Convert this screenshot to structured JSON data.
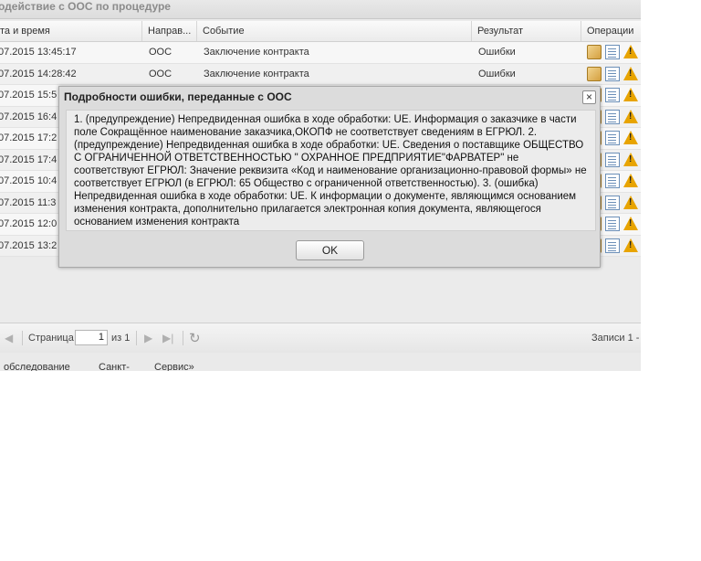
{
  "panel": {
    "title": "одействие с ООС по процедуре"
  },
  "grid": {
    "columns": [
      "та и время",
      "Направ...",
      "Событие",
      "Результат",
      "Операции"
    ],
    "rows": [
      {
        "datetime": "07.2015 13:45:17",
        "direction": "ООС",
        "event": "Заключение контракта",
        "result": "Ошибки"
      },
      {
        "datetime": "07.2015 14:28:42",
        "direction": "ООС",
        "event": "Заключение контракта",
        "result": "Ошибки"
      },
      {
        "datetime": "07.2015 15:5",
        "direction": "",
        "event": "",
        "result": ""
      },
      {
        "datetime": "07.2015 16:4",
        "direction": "",
        "event": "",
        "result": ""
      },
      {
        "datetime": "07.2015 17:2",
        "direction": "",
        "event": "",
        "result": ""
      },
      {
        "datetime": "07.2015 17:4",
        "direction": "",
        "event": "",
        "result": ""
      },
      {
        "datetime": "07.2015 10:4",
        "direction": "",
        "event": "",
        "result": ""
      },
      {
        "datetime": "07.2015 11:3",
        "direction": "",
        "event": "",
        "result": ""
      },
      {
        "datetime": "07.2015 12:0",
        "direction": "",
        "event": "",
        "result": ""
      },
      {
        "datetime": "07.2015 13:2",
        "direction": "",
        "event": "",
        "result": ""
      }
    ],
    "icons": [
      "package-icon",
      "document-icon",
      "warning-icon"
    ]
  },
  "pager": {
    "page_label": "Страница",
    "page_value": "1",
    "of_label": "из 1",
    "records_label": "Записи 1 -"
  },
  "below": {
    "col1": "обследование",
    "col2": "Санкт-",
    "col3": "Сервис»"
  },
  "dialog": {
    "title": "Подробности ошибки, переданные с ООС",
    "close_symbol": "×",
    "message": "1. (предупреждение) Непредвиденная ошибка в ходе обработки: UE. Информация о заказчике в части поле Сокращённое наименование заказчика,ОКОПФ не соответствует сведениям в ЕГРЮЛ. 2. (предупреждение) Непредвиденная ошибка в ходе обработки: UE. Сведения о поставщике ОБЩЕСТВО С ОГРАНИЧЕННОЙ ОТВЕТСТВЕННОСТЬЮ \" ОХРАННОЕ ПРЕДПРИЯТИЕ\"ФАРВАТЕР\" не соответствуют ЕГРЮЛ: Значение реквизита «Код и наименование организационно-правовой формы» не соответствует ЕГРЮЛ (в ЕГРЮЛ: 65 Общество с ограниченной ответственностью). 3. (ошибка) Непредвиденная ошибка в ходе обработки: UE. К информации о документе, являющимся основанием изменения контракта, дополнительно прилагается электронная копия документа, являющегося основанием изменения контракта",
    "ok_label": "OK"
  }
}
